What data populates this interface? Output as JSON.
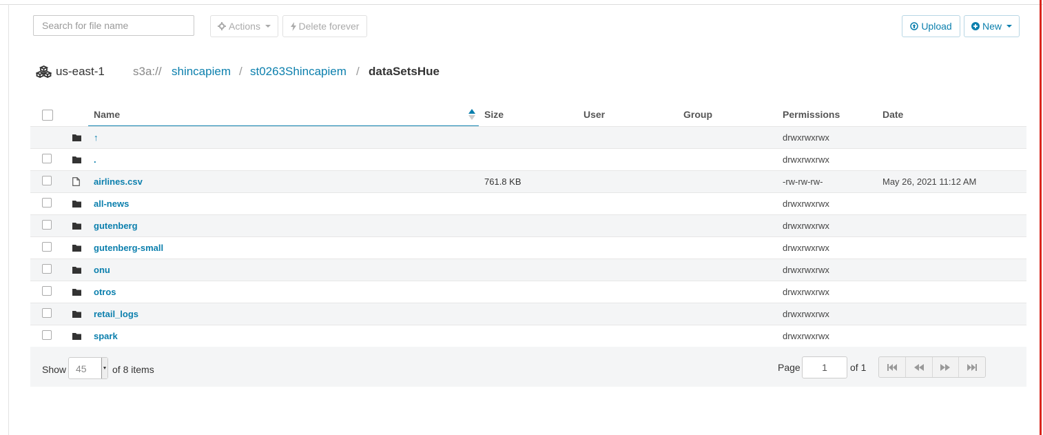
{
  "toolbar": {
    "search_placeholder": "Search for file name",
    "actions_label": "Actions",
    "delete_label": "Delete forever",
    "upload_label": "Upload",
    "new_label": "New"
  },
  "breadcrumb": {
    "region": "us-east-1",
    "scheme": "s3a://",
    "segments": [
      "shincapiem",
      "st0263Shincapiem",
      "dataSetsHue"
    ],
    "separator": "/"
  },
  "table": {
    "columns": [
      "Name",
      "Size",
      "User",
      "Group",
      "Permissions",
      "Date"
    ],
    "rows": [
      {
        "icon": "folder-icon",
        "name": "↑",
        "size": "",
        "user": "",
        "group": "",
        "permissions": "drwxrwxrwx",
        "date": ""
      },
      {
        "icon": "folder-icon",
        "name": ".",
        "size": "",
        "user": "",
        "group": "",
        "permissions": "drwxrwxrwx",
        "date": ""
      },
      {
        "icon": "file-icon",
        "name": "airlines.csv",
        "size": "761.8 KB",
        "user": "",
        "group": "",
        "permissions": "-rw-rw-rw-",
        "date": "May 26, 2021 11:12 AM"
      },
      {
        "icon": "folder-icon",
        "name": "all-news",
        "size": "",
        "user": "",
        "group": "",
        "permissions": "drwxrwxrwx",
        "date": ""
      },
      {
        "icon": "folder-icon",
        "name": "gutenberg",
        "size": "",
        "user": "",
        "group": "",
        "permissions": "drwxrwxrwx",
        "date": ""
      },
      {
        "icon": "folder-icon",
        "name": "gutenberg-small",
        "size": "",
        "user": "",
        "group": "",
        "permissions": "drwxrwxrwx",
        "date": ""
      },
      {
        "icon": "folder-icon",
        "name": "onu",
        "size": "",
        "user": "",
        "group": "",
        "permissions": "drwxrwxrwx",
        "date": ""
      },
      {
        "icon": "folder-icon",
        "name": "otros",
        "size": "",
        "user": "",
        "group": "",
        "permissions": "drwxrwxrwx",
        "date": ""
      },
      {
        "icon": "folder-icon",
        "name": "retail_logs",
        "size": "",
        "user": "",
        "group": "",
        "permissions": "drwxrwxrwx",
        "date": ""
      },
      {
        "icon": "folder-icon",
        "name": "spark",
        "size": "",
        "user": "",
        "group": "",
        "permissions": "drwxrwxrwx",
        "date": ""
      }
    ]
  },
  "footer": {
    "show_label": "Show",
    "page_size": "45",
    "items_label": "of 8 items",
    "page_label": "Page",
    "current_page": "1",
    "of_pages_label": "of 1"
  },
  "colors": {
    "link": "#0b7fad",
    "accent_bar": "#d9251d",
    "row_stripe": "#f4f5f6"
  }
}
